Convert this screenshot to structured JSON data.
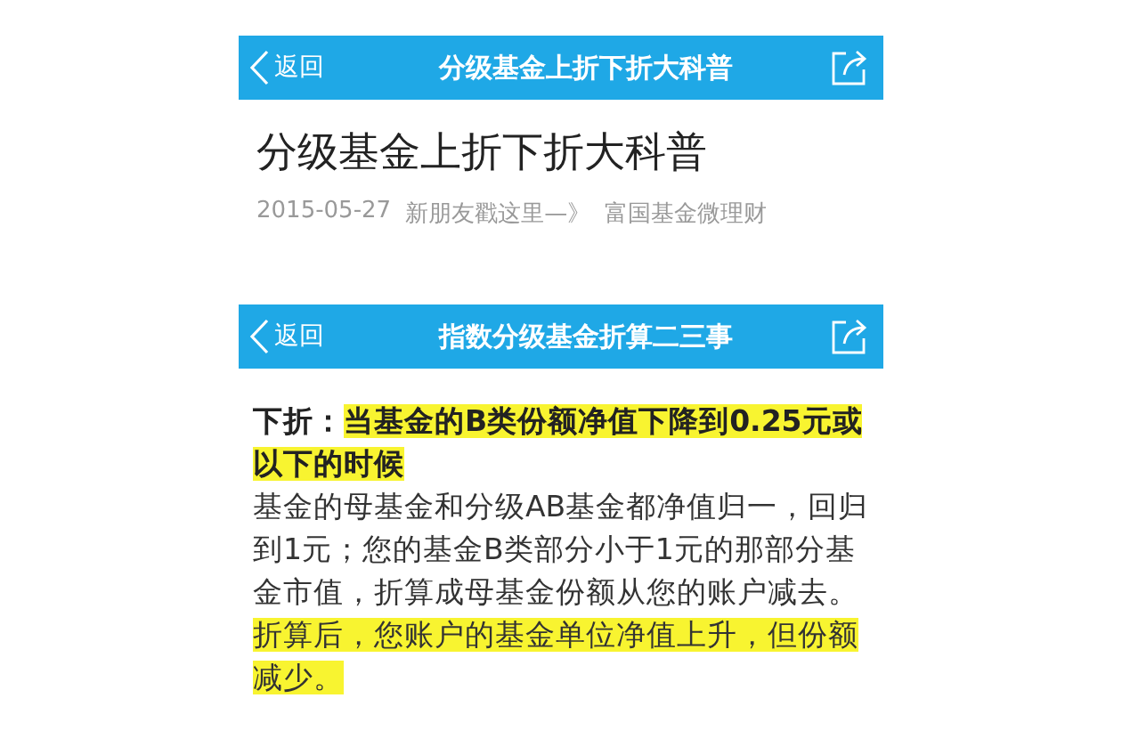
{
  "screens": [
    {
      "nav_bar": {
        "back_label": "返回",
        "title": "分级基金上折下折大科普"
      },
      "article": {
        "title": "分级基金上折下折大科普",
        "date": "2015-05-27",
        "link": "新朋友戳这里—》",
        "author": "富国基金微理财"
      }
    },
    {
      "nav_bar": {
        "back_label": "返回",
        "title": "指数分级基金折算二三事"
      },
      "body": {
        "paragraphs": [
          {
            "segments": [
              {
                "text": "下折：",
                "bold": true,
                "highlighted": false
              },
              {
                "text": "当基金的B类份额净值下降到0.25元或以下的时候",
                "bold": true,
                "highlighted": true
              }
            ]
          },
          {
            "segments": [
              {
                "text": "基金的母基金和分级AB基金都净值归一，回归到1元；您的基金B类部分小于1元的那部分基金市值，折算成母基金份额从您的账户减去。",
                "bold": false,
                "highlighted": false
              }
            ]
          },
          {
            "segments": [
              {
                "text": "折算后，您账户的基金单位净值上升，但份额减少。",
                "bold": false,
                "highlighted": true
              }
            ]
          }
        ]
      }
    }
  ]
}
